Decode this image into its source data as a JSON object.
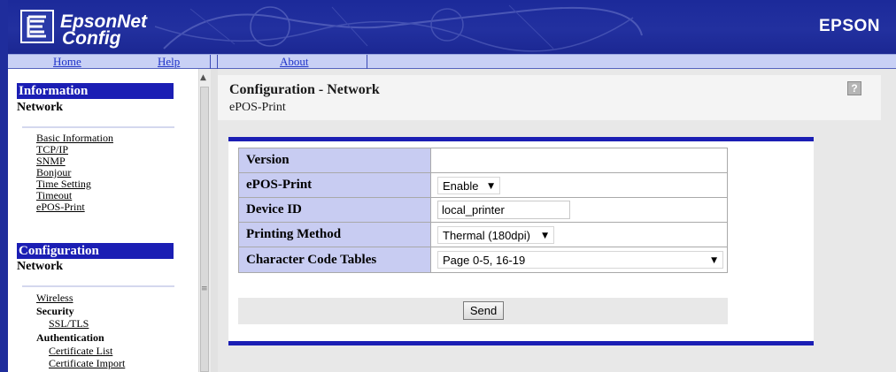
{
  "header": {
    "logo_line1": "EpsonNet",
    "logo_line2": "Config",
    "brand": "EPSON"
  },
  "nav": {
    "home": "Home",
    "help": "Help",
    "about": "About"
  },
  "sidebar": {
    "information": {
      "heading": "Information",
      "subheading": "Network",
      "links": [
        "Basic Information",
        "TCP/IP",
        "SNMP",
        "Bonjour",
        "Time Setting",
        "Timeout",
        "ePOS-Print"
      ]
    },
    "configuration": {
      "heading": "Configuration",
      "subheading": "Network",
      "wireless": "Wireless",
      "security": "Security",
      "ssl_tls": "SSL/TLS",
      "authentication": "Authentication",
      "certificate_list": "Certificate List",
      "certificate_import": "Certificate Import"
    }
  },
  "main": {
    "title": "Configuration - Network",
    "subtitle": "ePOS-Print",
    "help_icon": "?",
    "form": {
      "version_label": "Version",
      "version_value": "",
      "epos_label": "ePOS-Print",
      "epos_value": "Enable",
      "device_id_label": "Device ID",
      "device_id_value": "local_printer",
      "printing_method_label": "Printing Method",
      "printing_method_value": "Thermal (180dpi)",
      "char_code_label": "Character Code Tables",
      "char_code_value": "Page 0-5, 16-19"
    },
    "send_label": "Send"
  },
  "colors": {
    "banner": "#1c2a9a",
    "nav_bg": "#c8d0f5",
    "section_head": "#1b1eb4",
    "label_cell": "#c8ccf2",
    "accent_bar": "#1b1eb4"
  }
}
